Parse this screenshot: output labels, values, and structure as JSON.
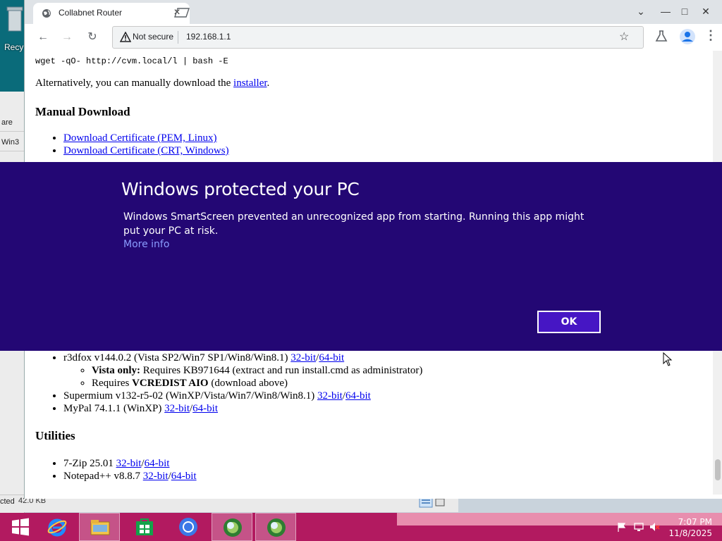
{
  "desktop": {
    "recycle_label": "Recy",
    "explorer_rows": [
      "are",
      "Win3"
    ],
    "status_text": "cted",
    "status_size": "42.0 KB"
  },
  "browser": {
    "tab_title": "Collabnet Router",
    "security_label": "Not secure",
    "url": "192.168.1.1",
    "window_controls": {
      "minimize": "—",
      "maximize": "□",
      "close": "✕"
    }
  },
  "page": {
    "command": "wget -qO- http://cvm.local/l | bash -E",
    "alt_text": "Alternatively, you can manually download the ",
    "alt_link": "installer",
    "alt_suffix": ".",
    "manual_heading": "Manual Download",
    "manual_links": [
      "Download Certificate (PEM, Linux)",
      "Download Certificate (CRT, Windows)"
    ],
    "browsers": [
      {
        "name": "r3dfox v144.0.2 (Vista SP2/Win7 SP1/Win8/Win8.1) ",
        "link32": "32-bit",
        "link64": "64-bit"
      },
      {
        "name": "Supermium v132-r5-02 (WinXP/Vista/Win7/Win8/Win8.1) ",
        "link32": "32-bit",
        "link64": "64-bit"
      },
      {
        "name": "MyPal 74.1.1 (WinXP) ",
        "link32": "32-bit",
        "link64": "64-bit"
      }
    ],
    "r3dfox_notes": {
      "vista_bold": "Vista only:",
      "vista_rest": " Requires KB971644 (extract and run install.cmd as administrator)",
      "requires_prefix": "Requires ",
      "requires_bold": "VCREDIST AIO",
      "requires_suffix": " (download above)"
    },
    "utilities_heading": "Utilities",
    "utilities": [
      {
        "name": "7-Zip 25.01 ",
        "link32": "32-bit",
        "link64": "64-bit"
      },
      {
        "name": "Notepad++ v8.8.7 ",
        "link32": "32-bit",
        "link64": "64-bit"
      }
    ],
    "slash": "/"
  },
  "smartscreen": {
    "title": "Windows protected your PC",
    "body": "Windows SmartScreen prevented an unrecognized app from starting. Running this app might put your PC at risk.",
    "more_info": "More info",
    "ok_label": "OK",
    "background": "#230774",
    "link_color": "#8a9cff"
  },
  "taskbar": {
    "time": "7:07 PM",
    "date": "11/8/2025",
    "color": "#b21a60",
    "apps": [
      "start",
      "internet-explorer",
      "file-explorer",
      "store",
      "chromium",
      "browser-1",
      "browser-2"
    ]
  }
}
